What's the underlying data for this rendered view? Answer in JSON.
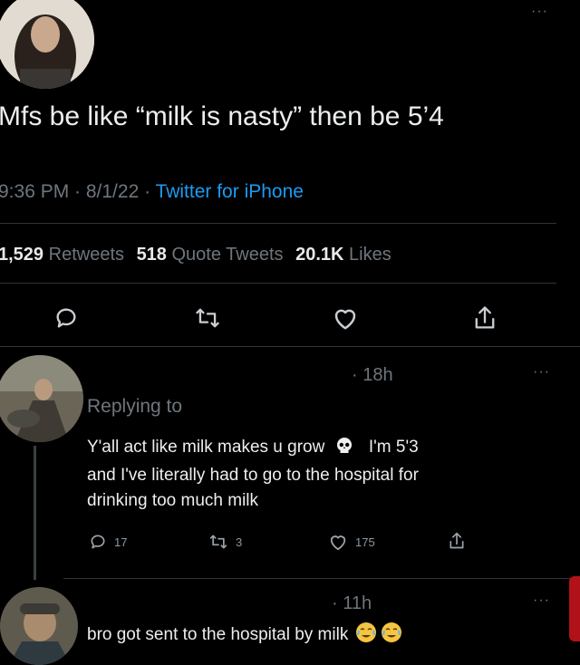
{
  "main_tweet": {
    "text": "Mfs be like “milk is nasty” then be 5’4",
    "meta_time_date": "9:36 PM · 8/1/22 · ",
    "meta_source": "Twitter for iPhone",
    "stats": {
      "retweets_count": "1,529",
      "retweets_label": "Retweets",
      "quote_count": "518",
      "quote_label": "Quote Tweets",
      "likes_count": "20.1K",
      "likes_label": "Likes"
    }
  },
  "replies": [
    {
      "time": "· 18h",
      "replying_to_label": "Replying to",
      "text_line1_a": "Y'all act like milk makes u grow",
      "text_line1_b": "I'm 5'3",
      "text_line2": "and I've literally had to go to the hospital for",
      "text_line3": "drinking too much milk",
      "reply_count": "17",
      "retweet_count": "3",
      "like_count": "175"
    },
    {
      "time": "· 11h",
      "text": "bro got sent to the hospital by milk"
    }
  ],
  "more_glyph": "···",
  "icons": [
    "reply-icon",
    "retweet-icon",
    "heart-icon",
    "share-icon",
    "skull-icon",
    "crying-face-icon"
  ]
}
